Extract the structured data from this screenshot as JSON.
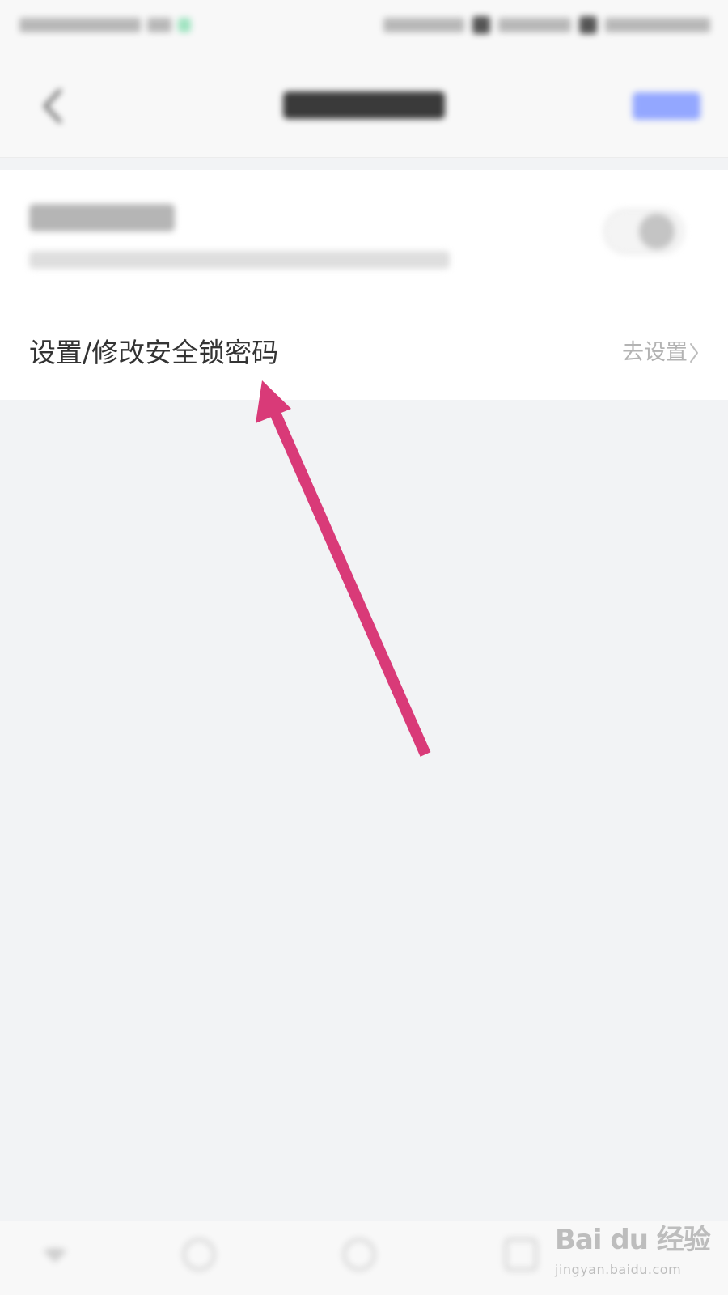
{
  "password_row": {
    "label": "设置/修改安全锁密码",
    "action": "去设置"
  },
  "watermark": {
    "logo": "Bai du 经验",
    "url": "jingyan.baidu.com"
  },
  "colors": {
    "annotation_arrow": "#d93a78",
    "background": "#f2f3f5",
    "card": "#ffffff",
    "nav_action": "#93a7ff"
  },
  "icons": {
    "back": "chevron-left-icon",
    "row_action": "chevron-right-icon",
    "annotation": "arrow-icon"
  }
}
